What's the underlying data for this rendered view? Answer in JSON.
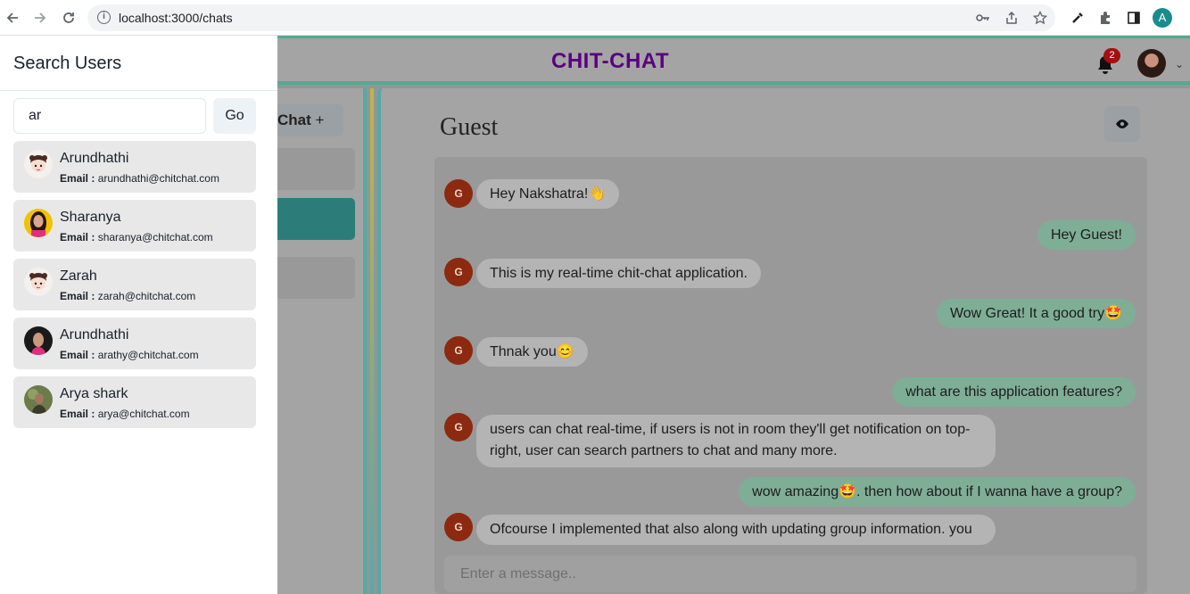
{
  "browser": {
    "url": "localhost:3000/chats",
    "profile_initial": "A"
  },
  "app": {
    "brand": "CHIT-CHAT",
    "notification_count": "2",
    "my_chats_label": "Chat",
    "chat_title": "Guest",
    "message_placeholder": "Enter a message..",
    "messages": [
      {
        "from": "guest",
        "avatar": "G",
        "text": "Hey Nakshatra!👋"
      },
      {
        "from": "me",
        "text": "Hey Guest!"
      },
      {
        "from": "guest",
        "avatar": "G",
        "text": "This is my real-time chit-chat application."
      },
      {
        "from": "me",
        "text": "Wow Great! It a good try🤩"
      },
      {
        "from": "guest",
        "avatar": "G",
        "text": "Thnak you😊"
      },
      {
        "from": "me",
        "text": "what are this application features?"
      },
      {
        "from": "guest",
        "avatar": "G",
        "text": "users can chat real-time, if users is not in room they'll get notification on top-right, user can search partners to chat and many more."
      },
      {
        "from": "me",
        "text": "wow amazing🤩. then how about if I wanna have a group?"
      },
      {
        "from": "guest",
        "avatar": "G",
        "text": "Ofcourse I implemented that also along with updating group information. you"
      }
    ]
  },
  "drawer": {
    "title": "Search Users",
    "search_value": "ar",
    "go_label": "Go",
    "email_label": "Email :",
    "users": [
      {
        "name": "Arundhathi",
        "email": "arundhathi@chitchat.com",
        "avatar": "cartoon-girl"
      },
      {
        "name": "Sharanya",
        "email": "sharanya@chitchat.com",
        "avatar": "photo-woman-yellow"
      },
      {
        "name": "Zarah",
        "email": "zarah@chitchat.com",
        "avatar": "cartoon-girl"
      },
      {
        "name": "Arundhathi",
        "email": "arathy@chitchat.com",
        "avatar": "photo-woman-dark"
      },
      {
        "name": "Arya shark",
        "email": "arya@chitchat.com",
        "avatar": "photo-outdoor"
      }
    ]
  }
}
